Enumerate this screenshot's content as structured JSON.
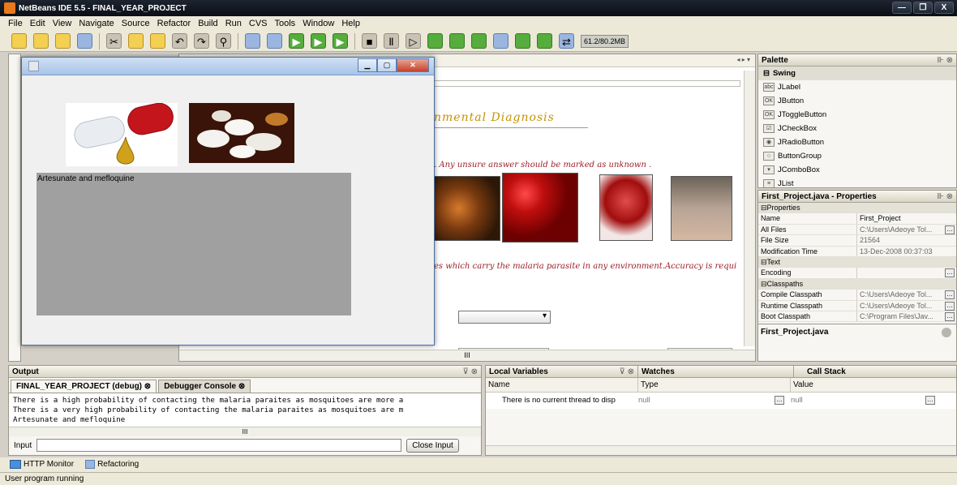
{
  "window": {
    "title": "NetBeans IDE 5.5 - FINAL_YEAR_PROJECT",
    "controls": [
      "—",
      "❐",
      "X"
    ]
  },
  "menu": [
    "File",
    "Edit",
    "View",
    "Navigate",
    "Source",
    "Refactor",
    "Build",
    "Run",
    "CVS",
    "Tools",
    "Window",
    "Help"
  ],
  "toolbar": {
    "memory": "61.2/80.2MB"
  },
  "editor": {
    "heading": "nmental Diagnosis",
    "notice": ". Any unsure answer should be marked as unknown .",
    "notice2": "es which carry the malaria parasite in any environment.Accuracy is requi",
    "hscroll_label": "III"
  },
  "palette": {
    "title": "Palette",
    "category": "Swing",
    "items": [
      {
        "icon": "label",
        "label": "JLabel"
      },
      {
        "icon": "ok",
        "label": "JButton"
      },
      {
        "icon": "ok",
        "label": "JToggleButton"
      },
      {
        "icon": "check",
        "label": "JCheckBox"
      },
      {
        "icon": "radio",
        "label": "JRadioButton"
      },
      {
        "icon": "group",
        "label": "ButtonGroup"
      },
      {
        "icon": "combo",
        "label": "JComboBox"
      },
      {
        "icon": "list",
        "label": "JList"
      }
    ]
  },
  "properties": {
    "title": "First_Project.java - Properties",
    "groups": {
      "properties": "Properties",
      "text": "Text",
      "classpaths": "Classpaths"
    },
    "rows": {
      "name": {
        "k": "Name",
        "v": "First_Project"
      },
      "all_files": {
        "k": "All Files",
        "v": "C:\\Users\\Adeoye Tol..."
      },
      "file_size": {
        "k": "File Size",
        "v": "21564"
      },
      "mod_time": {
        "k": "Modification Time",
        "v": "13-Dec-2008 00:37:03"
      },
      "encoding": {
        "k": "Encoding",
        "v": ""
      },
      "compile_cp": {
        "k": "Compile Classpath",
        "v": "C:\\Users\\Adeoye Tol..."
      },
      "runtime_cp": {
        "k": "Runtime Classpath",
        "v": "C:\\Users\\Adeoye Tol..."
      },
      "boot_cp": {
        "k": "Boot Classpath",
        "v": "C:\\Program Files\\Jav..."
      }
    },
    "footer": "First_Project.java"
  },
  "output": {
    "title": "Output",
    "tabs": [
      "FINAL_YEAR_PROJECT (debug)",
      "Debugger Console"
    ],
    "lines": [
      "There is a high probability of contacting the malaria paraites as mosquitoes are more a",
      "There is a very high probability of contacting the malaria paraites as mosquitoes are m",
      "Artesunate and  mefloquine"
    ],
    "input_label": "Input",
    "close_input": "Close Input",
    "hscroll_label": "III"
  },
  "locals": {
    "tabs": [
      "Local Variables",
      "Watches",
      "Call Stack"
    ],
    "columns": [
      "Name",
      "Type",
      "Value"
    ],
    "row": {
      "name": "There is no current thread to disp",
      "type": "null",
      "value": "null"
    }
  },
  "bottom": {
    "items": [
      "HTTP Monitor",
      "Refactoring"
    ],
    "status": "User program running"
  },
  "dialog": {
    "text": "Artesunate and  mefloquine"
  }
}
